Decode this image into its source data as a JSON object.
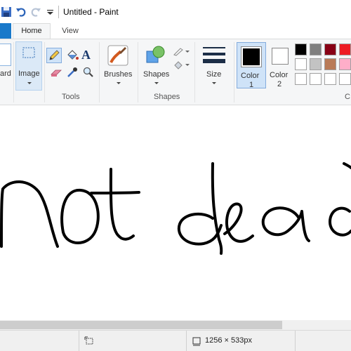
{
  "window": {
    "title": "Untitled - Paint"
  },
  "tabs": {
    "home": "Home",
    "view": "View"
  },
  "ribbon": {
    "clipboard_label": "ard",
    "image_label": "Image",
    "tools_group": "Tools",
    "brushes_label": "Brushes",
    "shapes_label": "Shapes",
    "shapes_group": "Shapes",
    "size_label": "Size",
    "color1_label": "Color",
    "color1_num": "1",
    "color2_label": "Color",
    "color2_num": "2",
    "colors_group_partial": "C",
    "color1_value": "#000000",
    "color2_value": "#ffffff",
    "palette_row1": [
      "#000000",
      "#7f7f7f",
      "#880015",
      "#ed1c24"
    ],
    "palette_row2": [
      "#ffffff",
      "#c3c3c3",
      "#b97a57",
      "#ffaec9"
    ],
    "palette_row3": [
      "#ffffff",
      "#ffffff",
      "#ffffff",
      "#ffffff"
    ]
  },
  "canvas": {
    "handwritten_text": "not dead"
  },
  "status": {
    "image_size": "1256 × 533px"
  }
}
